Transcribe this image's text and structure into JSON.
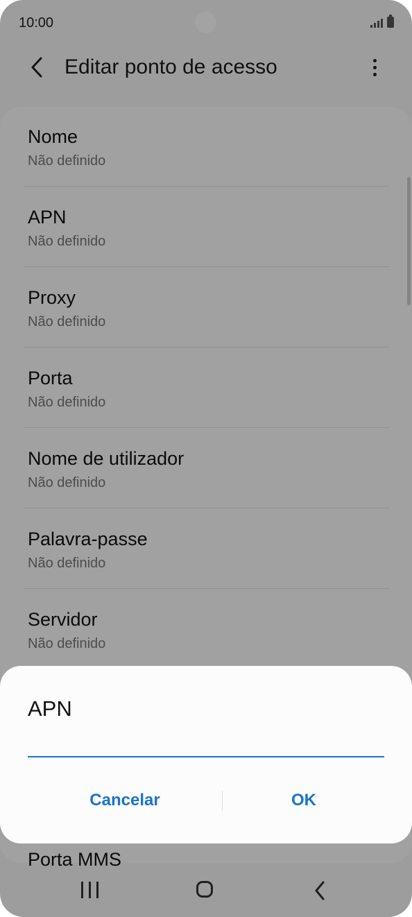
{
  "status_bar": {
    "time": "10:00"
  },
  "app_bar": {
    "title": "Editar ponto de acesso",
    "back_icon": "chevron-left-icon",
    "more_icon": "more-vertical-icon"
  },
  "settings": [
    {
      "label": "Nome",
      "value": "Não definido"
    },
    {
      "label": "APN",
      "value": "Não definido"
    },
    {
      "label": "Proxy",
      "value": "Não definido"
    },
    {
      "label": "Porta",
      "value": "Não definido"
    },
    {
      "label": "Nome de utilizador",
      "value": "Não definido"
    },
    {
      "label": "Palavra-passe",
      "value": "Não definido"
    },
    {
      "label": "Servidor",
      "value": "Não definido"
    },
    {
      "label": "Porta MMS",
      "value": ""
    }
  ],
  "dialog": {
    "title": "APN",
    "input_value": "",
    "cancel_label": "Cancelar",
    "ok_label": "OK"
  },
  "colors": {
    "accent": "#1a74c9",
    "scrim": "rgba(0,0,0,0.36)"
  }
}
